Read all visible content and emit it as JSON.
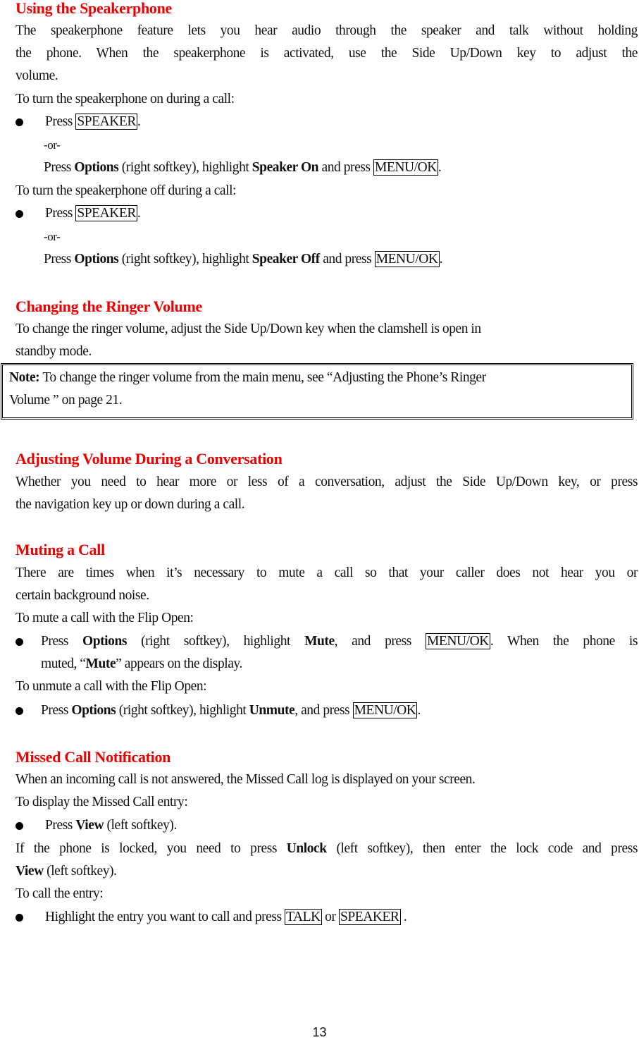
{
  "page_number": "13",
  "sections": {
    "speakerphone": {
      "heading": "Using the Speakerphone",
      "intro_line1": "The speakerphone feature lets you hear audio through the speaker and talk without holding",
      "intro_line2": "the phone. When the speakerphone is activated, use the Side Up/Down key to adjust the",
      "intro_line3": "volume.",
      "on_label": "To turn the speakerphone on during a call:",
      "off_label": "To turn the speakerphone off during a call:",
      "press": "Press",
      "speaker_key": "SPEAKER",
      "or": "-or-",
      "options": "Options",
      "right_softkey_highlight": "(right softkey), highlight",
      "speaker_on": "Speaker On",
      "speaker_off": "Speaker Off",
      "and_press": "and press",
      "menu_ok": "MENU/OK",
      "period": "."
    },
    "ringer": {
      "heading": "Changing the Ringer Volume",
      "line1": "To change the ringer volume, adjust the Side Up/Down key when the clamshell is open in",
      "line2": "standby mode.",
      "note_label": "Note:",
      "note_line1": "To change the ringer volume from the main menu, see “Adjusting the Phone’s Ringer",
      "note_line2": "Volume ” on page 21."
    },
    "conversation": {
      "heading": "Adjusting Volume During a Conversation",
      "line1": "Whether you need to hear more or less of a conversation, adjust the Side Up/Down key, or press",
      "line2": "the navigation key up or down during a call."
    },
    "muting": {
      "heading": "Muting a Call",
      "line1": "There are times when it’s necessary to mute a call so that your caller does not hear you or",
      "line2": "certain background noise.",
      "mute_label": "To mute a call with the Flip Open:",
      "press": "Press",
      "options": "Options",
      "rs_highlight": "(right softkey), highlight",
      "mute": "Mute",
      "and_press": ", and press",
      "menu_ok": "MENU/OK",
      "after_mute": ". When the phone is",
      "muted_line_a": "muted, “",
      "muted_line_b": "” appears on the display.",
      "unmute_label": "To unmute a call with the Flip Open:",
      "unmute": "Unmute"
    },
    "missed": {
      "heading": "Missed Call Notification",
      "line1": "When an incoming call is not answered, the Missed Call log is displayed on your screen.",
      "display_label": "To display the Missed Call entry:",
      "press": "Press",
      "view": "View",
      "left_softkey": "(left softkey).",
      "locked_a": "If the phone is locked, you need to press",
      "unlock": "Unlock",
      "locked_b": "(left softkey), then enter the lock code and press",
      "call_label": "To call the entry:",
      "highlight_text": "Highlight the entry you want to call and press",
      "talk_key": "TALK",
      "or_word": "or",
      "speaker_key": "SPEAKER",
      "end": " ."
    }
  }
}
